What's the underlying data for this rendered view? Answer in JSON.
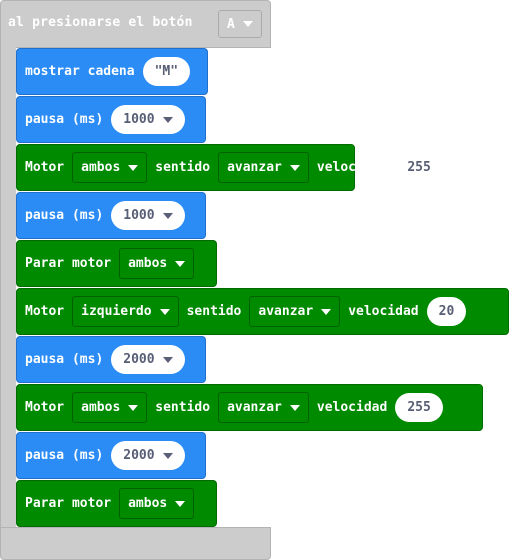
{
  "hat": {
    "title": "al presionarse el botón",
    "button_value": "A"
  },
  "blocks": [
    {
      "kind": "show_string",
      "label": "mostrar cadena",
      "value": "\"M\""
    },
    {
      "kind": "pause",
      "label": "pausa (ms)",
      "value": "1000"
    },
    {
      "kind": "motor",
      "label": "Motor",
      "motor": "ambos",
      "dir_label": "sentido",
      "direction": "avanzar",
      "speed_label": "velocidad",
      "speed": "255"
    },
    {
      "kind": "pause",
      "label": "pausa (ms)",
      "value": "1000"
    },
    {
      "kind": "stop",
      "label": "Parar motor",
      "motor": "ambos"
    },
    {
      "kind": "motor",
      "label": "Motor",
      "motor": "izquierdo",
      "dir_label": "sentido",
      "direction": "avanzar",
      "speed_label": "velocidad",
      "speed": "20"
    },
    {
      "kind": "pause",
      "label": "pausa (ms)",
      "value": "2000"
    },
    {
      "kind": "motor",
      "label": "Motor",
      "motor": "ambos",
      "dir_label": "sentido",
      "direction": "avanzar",
      "speed_label": "velocidad",
      "speed": "255"
    },
    {
      "kind": "pause",
      "label": "pausa (ms)",
      "value": "2000"
    },
    {
      "kind": "stop",
      "label": "Parar motor",
      "motor": "ambos"
    }
  ],
  "colors": {
    "event": "#cccccc",
    "basic": "#2c8cf5",
    "motor": "#008a00"
  }
}
